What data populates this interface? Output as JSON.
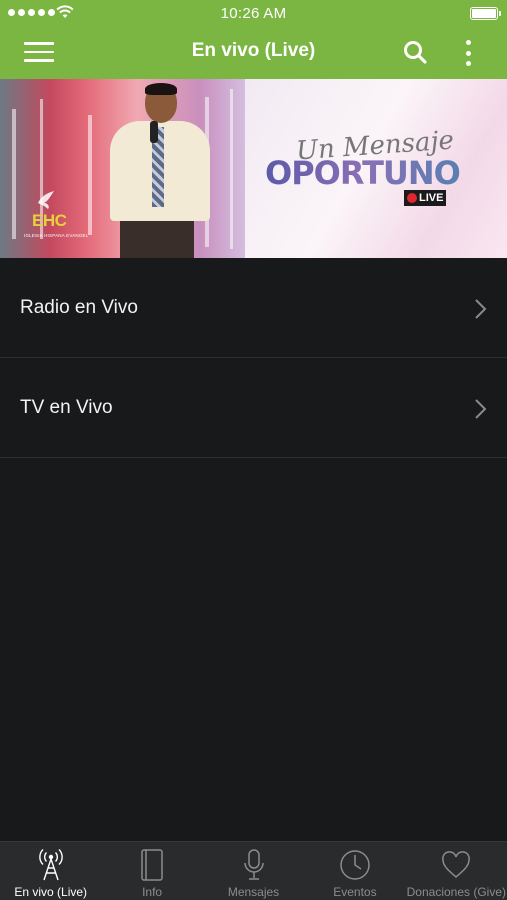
{
  "status_bar": {
    "time": "10:26 AM"
  },
  "navbar": {
    "title": "En vivo (Live)",
    "menu_icon": "hamburger-icon",
    "search_icon": "search-icon",
    "more_icon": "more-vertical-icon"
  },
  "banner": {
    "script_text": "Un Mensaje",
    "headline": "OPORTUNO",
    "badge": "LIVE",
    "logo_text": "EHC",
    "logo_subtext": "IGLESIA HISPANA EVANGEL"
  },
  "list": {
    "items": [
      {
        "label": "Radio en Vivo",
        "icon": "chevron-right-icon"
      },
      {
        "label": "TV en Vivo",
        "icon": "chevron-right-icon"
      }
    ]
  },
  "tabbar": {
    "tabs": [
      {
        "label": "En vivo (Live)",
        "icon": "broadcast-tower-icon",
        "active": true
      },
      {
        "label": "Info",
        "icon": "book-icon",
        "active": false
      },
      {
        "label": "Mensajes",
        "icon": "microphone-icon",
        "active": false
      },
      {
        "label": "Eventos",
        "icon": "clock-icon",
        "active": false
      },
      {
        "label": "Donaciones (Give)",
        "icon": "heart-icon",
        "active": false
      }
    ]
  },
  "colors": {
    "accent": "#7bb542",
    "background": "#18191b",
    "tabbar": "#2a2b2d",
    "live_red": "#e2262e"
  }
}
